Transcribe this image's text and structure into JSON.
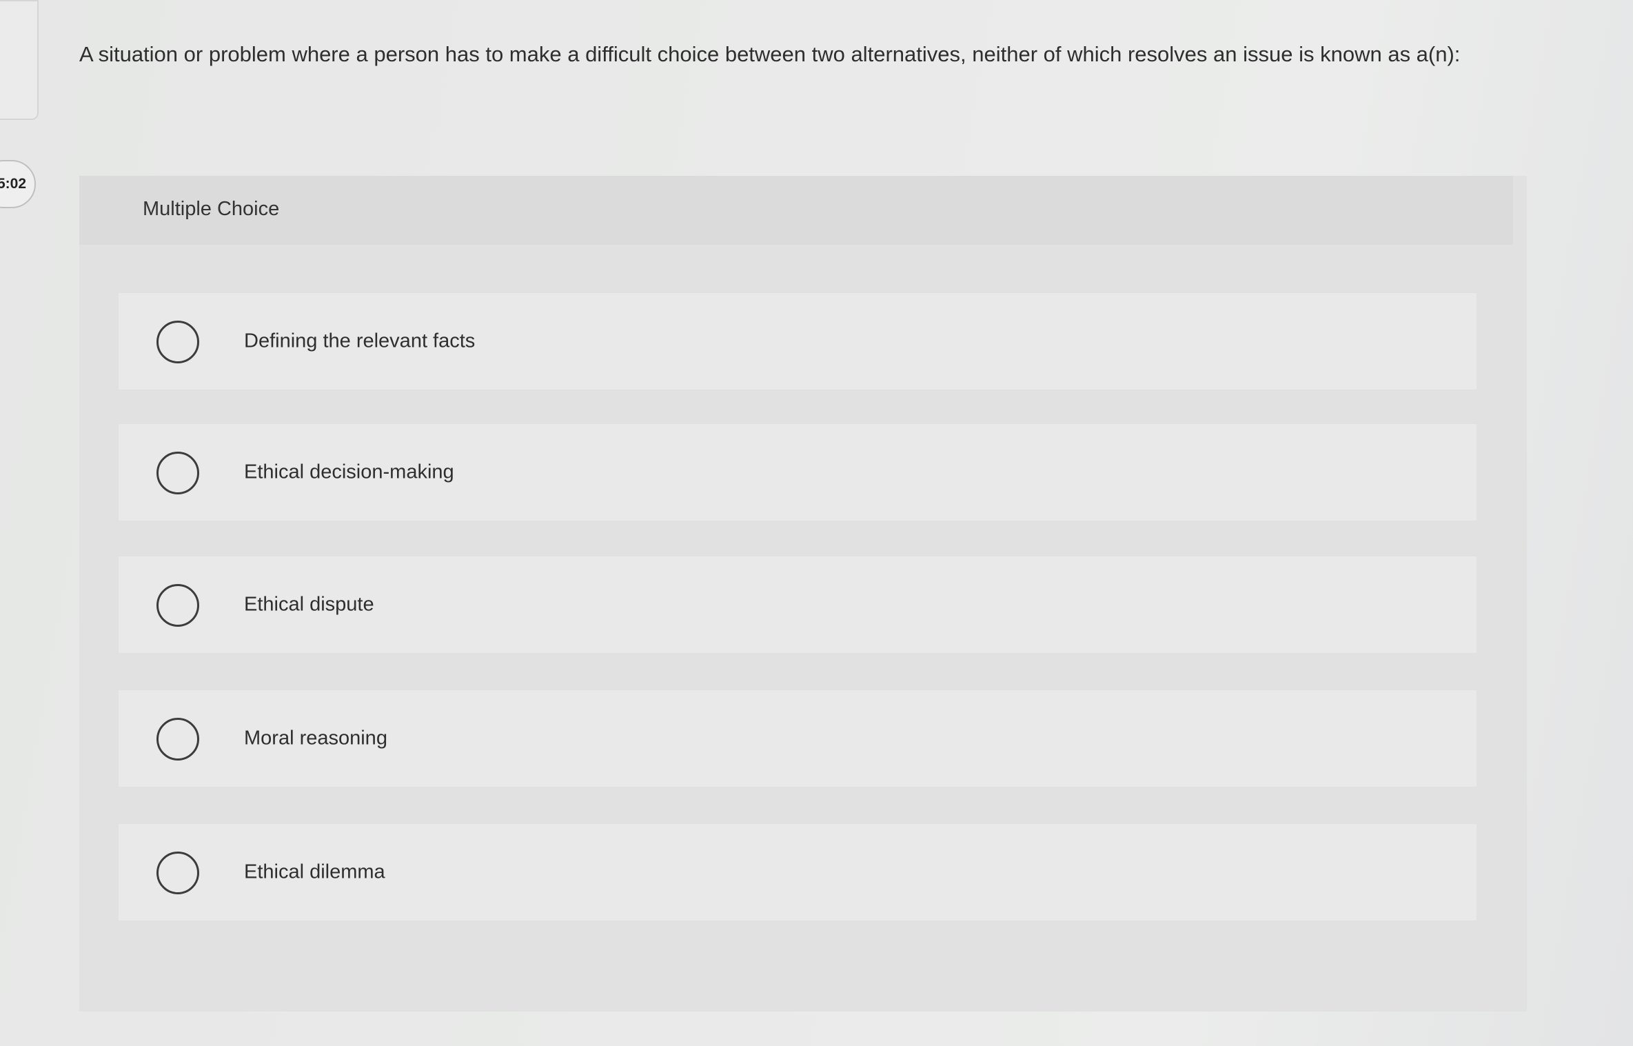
{
  "timer": {
    "label": "5:02"
  },
  "question": {
    "text": "A situation or problem where a person has to make a difficult choice between two alternatives, neither of which resolves an issue is known as a(n):"
  },
  "multiple_choice": {
    "header": "Multiple Choice",
    "options": [
      {
        "label": "Defining the relevant facts"
      },
      {
        "label": "Ethical decision-making"
      },
      {
        "label": "Ethical dispute"
      },
      {
        "label": "Moral reasoning"
      },
      {
        "label": "Ethical dilemma"
      }
    ]
  }
}
